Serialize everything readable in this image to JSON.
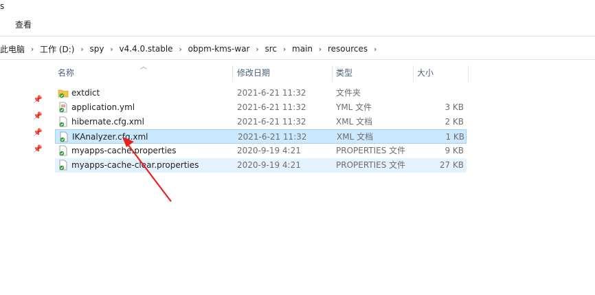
{
  "window": {
    "title_fragment": "s"
  },
  "ribbon": {
    "tab_view": "查看"
  },
  "breadcrumb": [
    "此电脑",
    "工作 (D:)",
    "spy",
    "v4.4.0.stable",
    "obpm-kms-war",
    "src",
    "main",
    "resources"
  ],
  "columns": {
    "name": "名称",
    "date": "修改日期",
    "type": "类型",
    "size": "大小"
  },
  "files": [
    {
      "name": "extdict",
      "date": "2021-6-21 11:32",
      "type": "文件夹",
      "size": "",
      "icon": "folder-icon"
    },
    {
      "name": "application.yml",
      "date": "2021-6-21 11:32",
      "type": "YML 文件",
      "size": "3 KB",
      "icon": "yml-file-icon"
    },
    {
      "name": "hibernate.cfg.xml",
      "date": "2021-6-21 11:32",
      "type": "XML 文档",
      "size": "2 KB",
      "icon": "xml-file-icon"
    },
    {
      "name": "IKAnalyzer.cfg.xml",
      "date": "2021-6-21 11:32",
      "type": "XML 文档",
      "size": "1 KB",
      "icon": "xml-file-icon"
    },
    {
      "name": "myapps-cache.properties",
      "date": "2020-9-19 4:21",
      "type": "PROPERTIES 文件",
      "size": "9 KB",
      "icon": "properties-file-icon"
    },
    {
      "name": "myapps-cache-clear.properties",
      "date": "2020-9-19 4:21",
      "type": "PROPERTIES 文件",
      "size": "27 KB",
      "icon": "properties-file-icon"
    }
  ],
  "selection": {
    "selected_file": "IKAnalyzer.cfg.xml",
    "hovered_file": "myapps-cache-clear.properties"
  },
  "colors": {
    "selected_bg": "#cce8ff",
    "selected_border": "#99d1ff",
    "hover_bg": "#e5f3ff",
    "annotation_arrow": "#e8211d",
    "header_text": "#4c607a"
  }
}
